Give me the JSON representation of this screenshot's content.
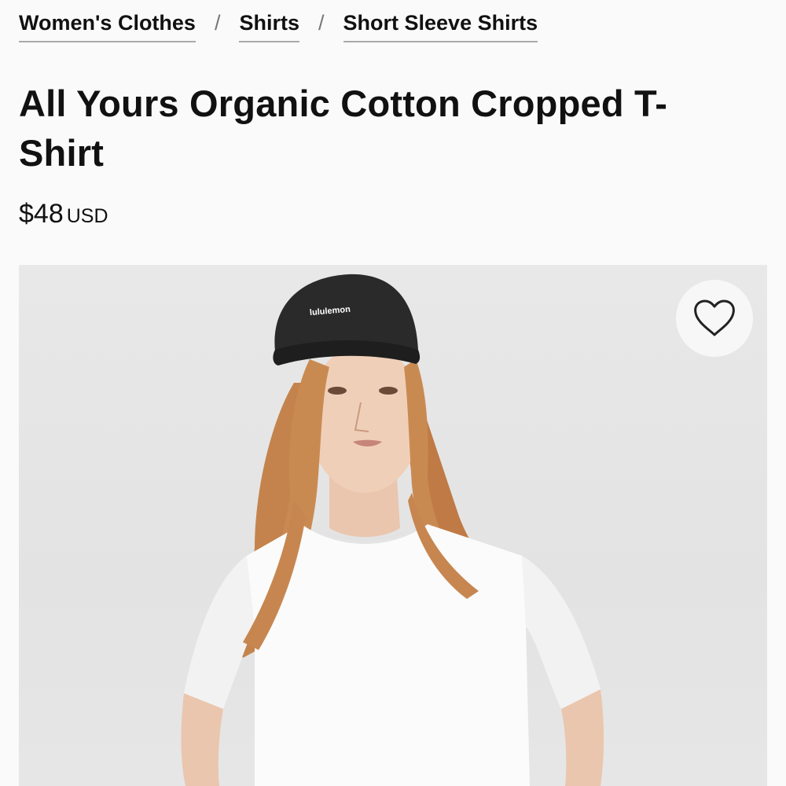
{
  "breadcrumb": [
    {
      "label": "Women's Clothes"
    },
    {
      "label": "Shirts"
    },
    {
      "label": "Short Sleeve Shirts"
    }
  ],
  "breadcrumb_separator": "/",
  "product": {
    "title": "All Yours Organic Cotton Cropped T-Shirt",
    "price": "$48",
    "currency": "USD"
  },
  "image": {
    "cap_logo": "lululemon"
  },
  "icons": {
    "wishlist": "heart-outline-icon"
  }
}
